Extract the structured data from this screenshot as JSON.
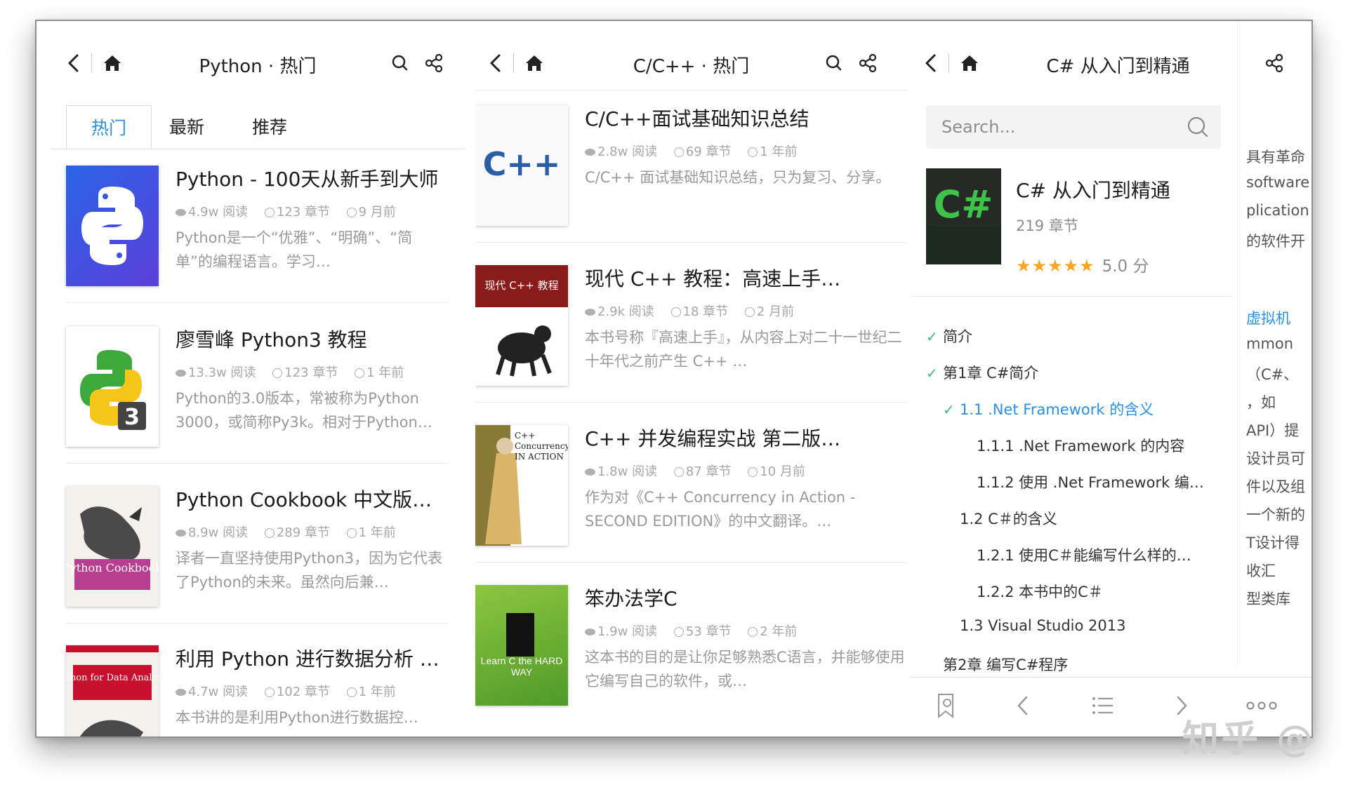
{
  "panel1": {
    "title": "Python · 热门",
    "tabs": [
      "热门",
      "最新",
      "推荐"
    ],
    "books": [
      {
        "title": "Python - 100天从新手到大师",
        "reads": "4.9w 阅读",
        "chapters": "123 章节",
        "time": "9 月前",
        "desc": "Python是一个“优雅”、“明确”、“简单”的编程语言。学习…",
        "cover": "python-logo"
      },
      {
        "title": "廖雪峰 Python3 教程",
        "reads": "13.3w 阅读",
        "chapters": "123 章节",
        "time": "1 年前",
        "desc": "Python的3.0版本，常被称为Python 3000，或简称Py3k。相对于Python…",
        "cover": "python3-logo"
      },
      {
        "title": "Python Cookbook 中文版…",
        "reads": "8.9w 阅读",
        "chapters": "289 章节",
        "time": "1 年前",
        "desc": "译者一直坚持使用Python3，因为它代表了Python的未来。虽然向后兼…",
        "cover": "python-cookbook",
        "cover_text": "Python Cookbook"
      },
      {
        "title": "利用 Python 进行数据分析 …",
        "reads": "4.7w 阅读",
        "chapters": "102 章节",
        "time": "1 年前",
        "desc": "本书讲的是利用Python进行数据控…",
        "cover": "python-data-analysis",
        "cover_text": "Python for Data Analysis"
      }
    ]
  },
  "panel2": {
    "title": "C/C++ · 热门",
    "books": [
      {
        "title": "C/C++面试基础知识总结",
        "reads": "2.8w 阅读",
        "chapters": "69 章节",
        "time": "1 年前",
        "desc": "C/C++ 面试基础知识总结，只为复习、分享。",
        "cover": "cpp-logo",
        "cover_text": "C++"
      },
      {
        "title": "现代 C++ 教程：高速上手…",
        "reads": "2.9k 阅读",
        "chapters": "18 章节",
        "time": "2 月前",
        "desc": "本书号称『高速上手』，从内容上对二十一世纪二十年代之前产生 C++ …",
        "cover": "modern-cpp",
        "cover_text": "现代 C++ 教程"
      },
      {
        "title": "C++ 并发编程实战 第二版…",
        "reads": "1.8w 阅读",
        "chapters": "87 章节",
        "time": "10 月前",
        "desc": "作为对《C++ Concurrency in Action - SECOND EDITION》的中文翻译。…",
        "cover": "cpp-concurrency",
        "cover_text": "C++ Concurrency IN ACTION"
      },
      {
        "title": "笨办法学C",
        "reads": "1.9w 阅读",
        "chapters": "53 章节",
        "time": "2 年前",
        "desc": "这本书的目的是让你足够熟悉C语言，并能够使用它编写自己的软件，或…",
        "cover": "learn-c-hard-way",
        "cover_text": "Learn C the HARD WAY"
      }
    ]
  },
  "panel3": {
    "title": "C# 从入门到精通",
    "search_placeholder": "Search...",
    "book": {
      "title": "C# 从入门到精通",
      "chapters": "219 章节",
      "stars": "★★★★★",
      "rating": "5.0 分",
      "cover_text": "C#"
    },
    "toc": [
      {
        "label": "简介",
        "checked": true,
        "level": 0
      },
      {
        "label": "第1章 C#简介",
        "checked": true,
        "level": 0
      },
      {
        "label": "1.1 .Net Framework 的含义",
        "checked": true,
        "level": 1,
        "current": true
      },
      {
        "label": "1.1.1 .Net Framework 的内容",
        "checked": false,
        "level": 2
      },
      {
        "label": "1.1.2 使用 .Net Framework 编…",
        "checked": false,
        "level": 2
      },
      {
        "label": "1.2 C＃的含义",
        "checked": false,
        "level": 1
      },
      {
        "label": "1.2.1 使用C＃能编写什么样的…",
        "checked": false,
        "level": 2
      },
      {
        "label": "1.2.2 本书中的C＃",
        "checked": false,
        "level": 2
      },
      {
        "label": "1.3 Visual Studio 2013",
        "checked": false,
        "level": 1
      },
      {
        "label": "第2章 编写C#程序",
        "checked": false,
        "level": 0
      }
    ],
    "right_strip": [
      "具有革命",
      "software",
      "plication",
      "的软件开",
      "虚拟机",
      "mmon",
      "（C#、",
      "，如",
      "API）提",
      "设计员可",
      "件以及组",
      "一个新的",
      "T设计得",
      "收汇",
      "型类库"
    ]
  },
  "watermark": "知乎 @"
}
